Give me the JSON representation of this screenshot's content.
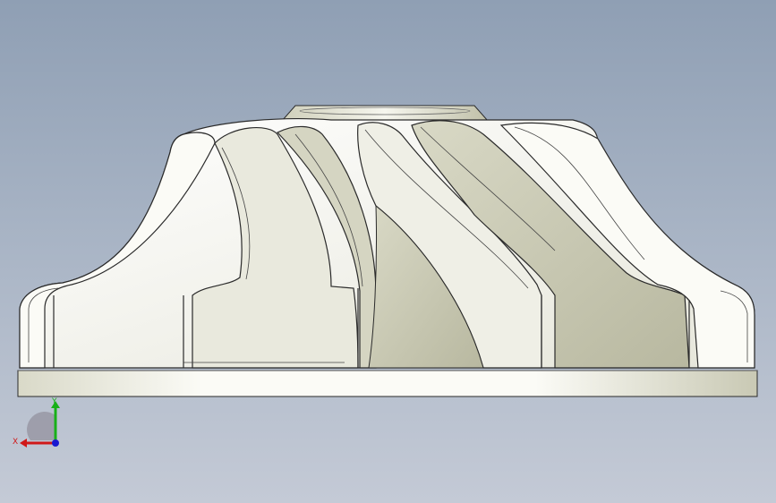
{
  "viewport": {
    "background_top": "#8f9fb4",
    "background_bottom": "#c4cad6",
    "model_color": "#f3f3ec",
    "edge_color": "#2a2a2a"
  },
  "triad": {
    "x_label": "X",
    "y_label": "Y",
    "x_color": "#d01818",
    "y_color": "#18b018",
    "z_color": "#1818d0"
  }
}
